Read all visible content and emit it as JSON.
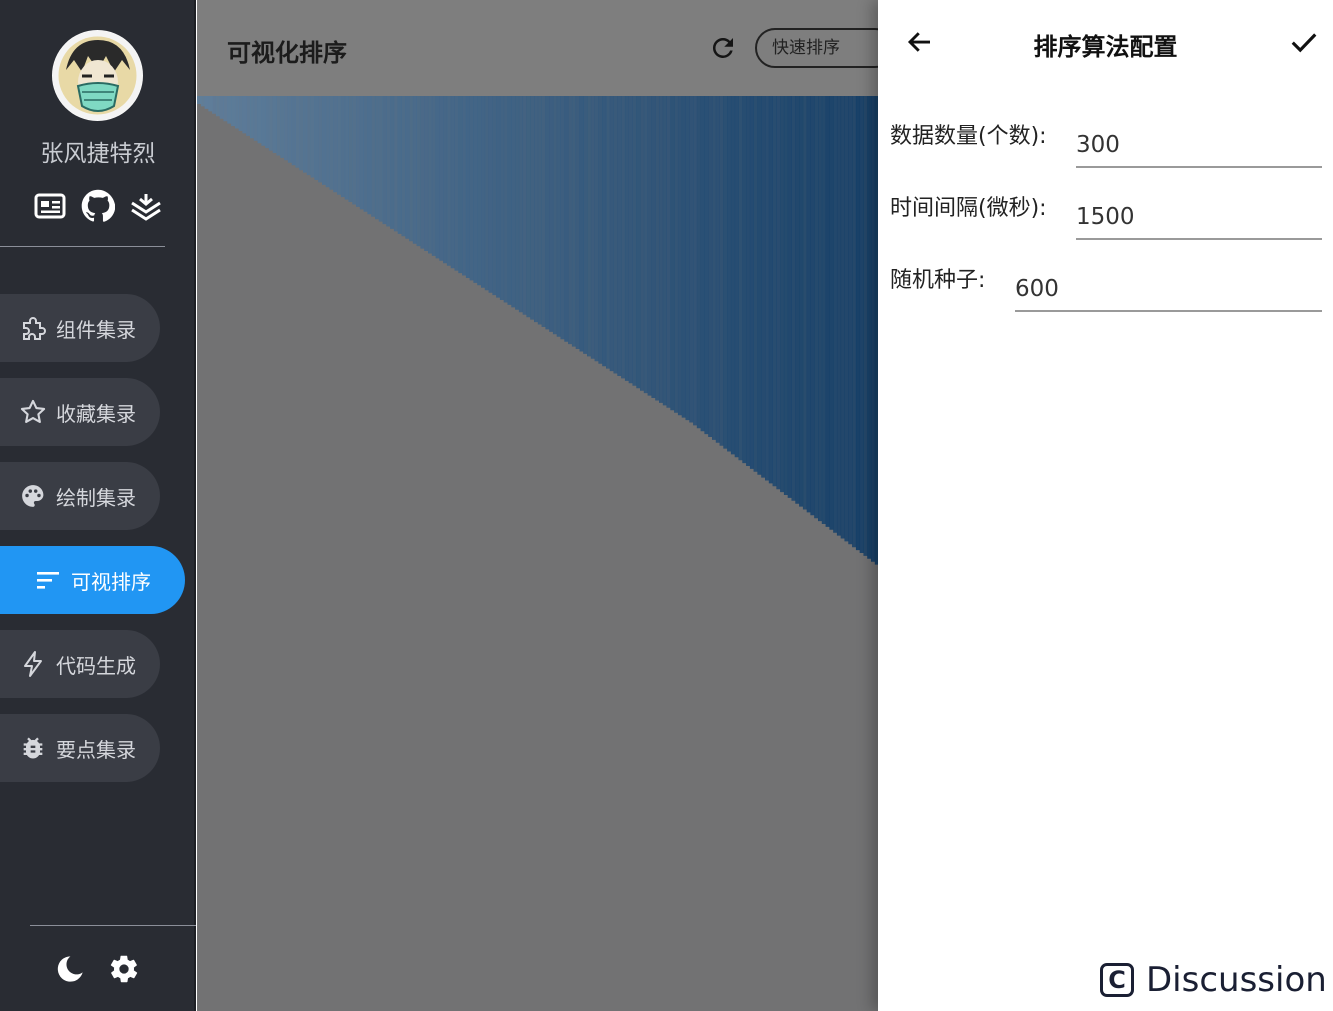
{
  "sidebar": {
    "user_name": "张风捷特烈",
    "social_icons": [
      "id-card-icon",
      "github-icon",
      "layers-icon"
    ],
    "nav_items": [
      {
        "label": "组件集录",
        "icon": "puzzle-icon",
        "active": false
      },
      {
        "label": "收藏集录",
        "icon": "star-icon",
        "active": false
      },
      {
        "label": "绘制集录",
        "icon": "palette-icon",
        "active": false
      },
      {
        "label": "可视排序",
        "icon": "sort-icon",
        "active": true
      },
      {
        "label": "代码生成",
        "icon": "bolt-icon",
        "active": false
      },
      {
        "label": "要点集录",
        "icon": "bug-icon",
        "active": false
      }
    ],
    "bottom_icons": [
      "moon-icon",
      "gear-icon"
    ]
  },
  "main": {
    "title": "可视化排序",
    "algorithm": "快速排序"
  },
  "drawer": {
    "title": "排序算法配置",
    "fields": [
      {
        "label": "数据数量(个数):",
        "value": "300"
      },
      {
        "label": "时间间隔(微秒):",
        "value": "1500"
      },
      {
        "label": "随机种子:",
        "value": "600"
      }
    ]
  },
  "footer": {
    "discussion_label": "Discussion",
    "discussion_icon_letter": "C"
  },
  "colors": {
    "sidebar_bg": "#292c33",
    "active_nav": "#2196f3",
    "overlay_bg": "#727273",
    "bar_light": "#5d7f9f",
    "bar_dark": "#0d3a66"
  },
  "chart_data": {
    "type": "bar",
    "description_values": "300 sorted descending values (max 300 at left, min 0 at right); bars drawn from top",
    "count": 300,
    "visible_count": 300,
    "sorted": "descending",
    "ylim": [
      0,
      300
    ]
  }
}
